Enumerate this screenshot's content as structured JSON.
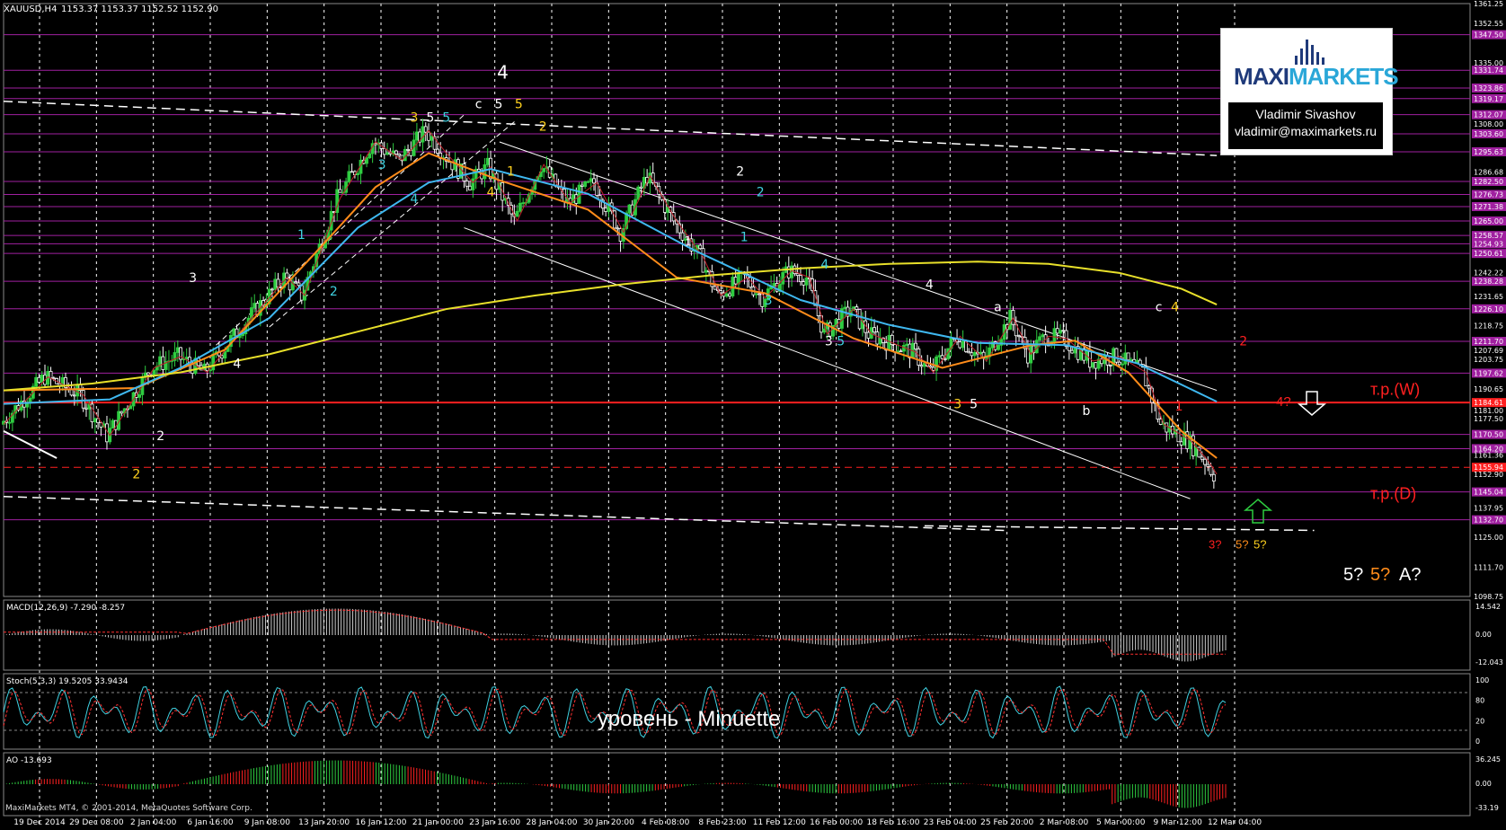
{
  "header": {
    "symbol": "XAUUSD,H4",
    "ohlc": "1153.37 1153.37 1152.52 1152.90"
  },
  "logo": {
    "brand_a": "MAXI",
    "brand_b": "MARKETS",
    "name": "Vladimir Sivashov",
    "email": "vladimir@maximarkets.ru"
  },
  "footer": "MaxiMarkets MT4, © 2001-2014, MetaQuotes Software Corp.",
  "overlay_text": "уровень - Minuette",
  "chart_data": {
    "type": "candlestick",
    "symbol": "XAUUSD",
    "timeframe": "H4",
    "ylim": [
      1098.75,
      1361.25
    ],
    "price_ticks": [
      "1361.25",
      "1352.55",
      "1347.50",
      "1335.00",
      "1331.74",
      "1323.86",
      "1319.17",
      "1312.07",
      "1308.00",
      "1303.60",
      "1295.63",
      "1286.68",
      "1282.50",
      "1276.73",
      "1271.38",
      "1265.00",
      "1258.57",
      "1254.93",
      "1250.61",
      "1242.22",
      "1238.28",
      "1231.65",
      "1226.10",
      "1218.75",
      "1211.70",
      "1207.69",
      "1203.75",
      "1197.62",
      "1190.65",
      "1184.61",
      "1181.00",
      "1177.50",
      "1170.50",
      "1164.20",
      "1161.36",
      "1155.94",
      "1152.90",
      "1145.04",
      "1137.95",
      "1132.70",
      "1125.00",
      "1111.70",
      "1098.75"
    ],
    "date_ticks": [
      "19 Dec 2014",
      "29 Dec 08:00",
      "2 Jan 04:00",
      "6 Jan 16:00",
      "9 Jan 08:00",
      "13 Jan 20:00",
      "16 Jan 12:00",
      "21 Jan 00:00",
      "23 Jan 16:00",
      "28 Jan 04:00",
      "30 Jan 20:00",
      "4 Feb 08:00",
      "8 Feb 23:00",
      "11 Feb 12:00",
      "16 Feb 00:00",
      "18 Feb 16:00",
      "23 Feb 04:00",
      "25 Feb 20:00",
      "2 Mar 08:00",
      "5 Mar 00:00",
      "9 Mar 12:00",
      "12 Mar 04:00"
    ],
    "price_path": [
      [
        0,
        1175
      ],
      [
        5,
        1196
      ],
      [
        9,
        1188
      ],
      [
        12,
        1170
      ],
      [
        17,
        1200
      ],
      [
        20,
        1205
      ],
      [
        23,
        1198
      ],
      [
        28,
        1222
      ],
      [
        32,
        1240
      ],
      [
        34,
        1232
      ],
      [
        38,
        1275
      ],
      [
        42,
        1300
      ],
      [
        45,
        1292
      ],
      [
        48,
        1305
      ],
      [
        50,
        1295
      ],
      [
        53,
        1282
      ],
      [
        55,
        1289
      ],
      [
        58,
        1265
      ],
      [
        61,
        1290
      ],
      [
        64,
        1273
      ],
      [
        67,
        1282
      ],
      [
        70,
        1260
      ],
      [
        73,
        1285
      ],
      [
        76,
        1265
      ],
      [
        79,
        1249
      ],
      [
        81,
        1232
      ],
      [
        84,
        1240
      ],
      [
        86,
        1231
      ],
      [
        89,
        1243
      ],
      [
        91,
        1240
      ],
      [
        93,
        1215
      ],
      [
        96,
        1226
      ],
      [
        98,
        1215
      ],
      [
        101,
        1210
      ],
      [
        103,
        1207
      ],
      [
        105,
        1198
      ],
      [
        108,
        1214
      ],
      [
        111,
        1203
      ],
      [
        114,
        1222
      ],
      [
        116,
        1206
      ],
      [
        118,
        1214
      ],
      [
        120,
        1213
      ],
      [
        123,
        1203
      ],
      [
        126,
        1205
      ],
      [
        129,
        1198
      ],
      [
        131,
        1175
      ],
      [
        134,
        1168
      ],
      [
        136,
        1159
      ],
      [
        137,
        1152.9
      ]
    ],
    "x_max": 138,
    "moving_averages": [
      {
        "color": "#ff8c1a",
        "points": [
          [
            0,
            1190
          ],
          [
            15,
            1191
          ],
          [
            25,
            1208
          ],
          [
            35,
            1250
          ],
          [
            42,
            1280
          ],
          [
            48,
            1295
          ],
          [
            56,
            1283
          ],
          [
            66,
            1270
          ],
          [
            76,
            1240
          ],
          [
            86,
            1233
          ],
          [
            96,
            1213
          ],
          [
            106,
            1200
          ],
          [
            116,
            1210
          ],
          [
            121,
            1212
          ],
          [
            127,
            1198
          ],
          [
            133,
            1172
          ],
          [
            137,
            1160
          ]
        ]
      },
      {
        "color": "#3fb8f0",
        "points": [
          [
            0,
            1184
          ],
          [
            12,
            1186
          ],
          [
            20,
            1200
          ],
          [
            30,
            1222
          ],
          [
            40,
            1262
          ],
          [
            48,
            1282
          ],
          [
            55,
            1288
          ],
          [
            66,
            1277
          ],
          [
            78,
            1252
          ],
          [
            90,
            1230
          ],
          [
            100,
            1219
          ],
          [
            110,
            1211
          ],
          [
            120,
            1210
          ],
          [
            128,
            1202
          ],
          [
            137,
            1185
          ]
        ]
      },
      {
        "color": "#e8e02a",
        "points": [
          [
            0,
            1190
          ],
          [
            10,
            1193
          ],
          [
            20,
            1198
          ],
          [
            30,
            1206
          ],
          [
            40,
            1216
          ],
          [
            50,
            1226
          ],
          [
            60,
            1232
          ],
          [
            70,
            1237
          ],
          [
            80,
            1241
          ],
          [
            90,
            1244
          ],
          [
            100,
            1246
          ],
          [
            110,
            1247
          ],
          [
            118,
            1246
          ],
          [
            126,
            1242
          ],
          [
            133,
            1235
          ],
          [
            137,
            1228
          ]
        ]
      }
    ],
    "horizontal_levels": [
      {
        "price": 1347.5,
        "color": "#a020a0"
      },
      {
        "price": 1331.74,
        "color": "#a020a0"
      },
      {
        "price": 1323.86,
        "color": "#a020a0"
      },
      {
        "price": 1319.17,
        "color": "#a020a0"
      },
      {
        "price": 1312.07,
        "color": "#a020a0"
      },
      {
        "price": 1303.6,
        "color": "#a020a0"
      },
      {
        "price": 1295.63,
        "color": "#a020a0"
      },
      {
        "price": 1282.5,
        "color": "#a020a0"
      },
      {
        "price": 1276.73,
        "color": "#a020a0"
      },
      {
        "price": 1271.38,
        "color": "#a020a0"
      },
      {
        "price": 1265.0,
        "color": "#a020a0"
      },
      {
        "price": 1258.57,
        "color": "#a020a0"
      },
      {
        "price": 1254.93,
        "color": "#a020a0"
      },
      {
        "price": 1250.61,
        "color": "#a020a0"
      },
      {
        "price": 1238.28,
        "color": "#a020a0"
      },
      {
        "price": 1226.1,
        "color": "#a020a0"
      },
      {
        "price": 1211.7,
        "color": "#a020a0"
      },
      {
        "price": 1197.62,
        "color": "#a020a0"
      },
      {
        "price": 1170.5,
        "color": "#a020a0"
      },
      {
        "price": 1164.2,
        "color": "#a020a0"
      },
      {
        "price": 1145.04,
        "color": "#a020a0"
      },
      {
        "price": 1132.7,
        "color": "#a020a0"
      },
      {
        "price": 1184.61,
        "color": "#ff2020",
        "width": 2
      },
      {
        "price": 1155.94,
        "color": "#ff2020",
        "dash": true
      }
    ],
    "wave_labels": [
      {
        "text": "2",
        "x": 16.5,
        "y": 1151,
        "color": "#ffd21e"
      },
      {
        "text": "2",
        "x": 19.5,
        "y": 1168,
        "color": "#ffffff"
      },
      {
        "text": "3",
        "x": 23.5,
        "y": 1238,
        "color": "#ffffff"
      },
      {
        "text": "4",
        "x": 29,
        "y": 1200,
        "color": "#ffffff"
      },
      {
        "text": "1",
        "x": 37,
        "y": 1257,
        "color": "#3fd0e0"
      },
      {
        "text": "2",
        "x": 41,
        "y": 1232,
        "color": "#3fd0e0"
      },
      {
        "text": "3",
        "x": 47,
        "y": 1288,
        "color": "#3fd0e0"
      },
      {
        "text": "4",
        "x": 51,
        "y": 1273,
        "color": "#3fd0e0"
      },
      {
        "text": "3",
        "x": 51,
        "y": 1309,
        "color": "#ffd21e"
      },
      {
        "text": "5",
        "x": 53,
        "y": 1309,
        "color": "#ffffff"
      },
      {
        "text": "5",
        "x": 55,
        "y": 1309,
        "color": "#3fd0e0"
      },
      {
        "text": "c",
        "x": 59,
        "y": 1315,
        "color": "#ffffff"
      },
      {
        "text": "4",
        "x": 62,
        "y": 1328,
        "color": "#ffffff"
      },
      {
        "text": "5",
        "x": 61.5,
        "y": 1315,
        "color": "#ffffff"
      },
      {
        "text": "5",
        "x": 64,
        "y": 1315,
        "color": "#ffd21e"
      },
      {
        "text": "1",
        "x": 63,
        "y": 1285,
        "color": "#ffd21e"
      },
      {
        "text": "4",
        "x": 60.5,
        "y": 1276,
        "color": "#ffd21e"
      },
      {
        "text": "2",
        "x": 67,
        "y": 1305,
        "color": "#ffd21e"
      },
      {
        "text": "2",
        "x": 91.5,
        "y": 1285,
        "color": "#ffffff"
      },
      {
        "text": "2",
        "x": 94,
        "y": 1276,
        "color": "#3fd0e0"
      },
      {
        "text": "1",
        "x": 85,
        "y": 1254,
        "color": "#ffffff"
      },
      {
        "text": "1",
        "x": 92,
        "y": 1256,
        "color": "#3fd0e0"
      },
      {
        "text": "4",
        "x": 102,
        "y": 1244,
        "color": "#3fd0e0"
      },
      {
        "text": "3",
        "x": 95,
        "y": 1228,
        "color": "#3fd0e0"
      },
      {
        "text": "3",
        "x": 102.5,
        "y": 1210,
        "color": "#ffffff"
      },
      {
        "text": "5",
        "x": 104,
        "y": 1210,
        "color": "#3fd0e0"
      },
      {
        "text": "4",
        "x": 115,
        "y": 1235,
        "color": "#ffffff"
      },
      {
        "text": "a",
        "x": 123.5,
        "y": 1225,
        "color": "#ffffff"
      },
      {
        "text": "3",
        "x": 118.5,
        "y": 1182,
        "color": "#ffd21e"
      },
      {
        "text": "5",
        "x": 120.5,
        "y": 1182,
        "color": "#ffffff"
      },
      {
        "text": "b",
        "x": 134.5,
        "y": 1179,
        "color": "#ffffff"
      },
      {
        "text": "c",
        "x": 143.5,
        "y": 1225,
        "color": "#ffffff"
      },
      {
        "text": "4",
        "x": 145.5,
        "y": 1225,
        "color": "#ffd21e"
      },
      {
        "text": "2",
        "x": 154,
        "y": 1210,
        "color": "#ff2020"
      },
      {
        "text": "1",
        "x": 146,
        "y": 1181,
        "color": "#ff2020"
      }
    ],
    "right_labels": [
      {
        "text": "т.р.(W)",
        "color": "#ff2020",
        "y": 1188
      },
      {
        "text": "4?",
        "color": "#ff2020",
        "y": 1183
      },
      {
        "text": "т.р.(D)",
        "color": "#ff2020",
        "y": 1142
      },
      {
        "text": "3?",
        "color": "#ff2020",
        "y": 1120
      },
      {
        "text": "5?",
        "color": "#ff8c1a",
        "y": 1120
      },
      {
        "text": "5?",
        "color": "#ffd21e",
        "y": 1120
      },
      {
        "text": "5?",
        "color": "#ffffff",
        "y": 1106
      },
      {
        "text": "5?",
        "color": "#ff8c1a",
        "y": 1106
      },
      {
        "text": "A?",
        "color": "#ffffff",
        "y": 1106
      }
    ],
    "indicators": {
      "macd": {
        "label": "MACD(12,26,9) -7.290 -8.257",
        "ticks": [
          "14.542",
          "0.00",
          "-12.043"
        ]
      },
      "stoch": {
        "label": "Stoch(5,3,3) 19.5205 33.9434",
        "ticks": [
          "100",
          "80",
          "20",
          "0"
        ]
      },
      "ao": {
        "label": "AO -13.693",
        "ticks": [
          "36.245",
          "0.00",
          "-33.19"
        ]
      }
    }
  }
}
